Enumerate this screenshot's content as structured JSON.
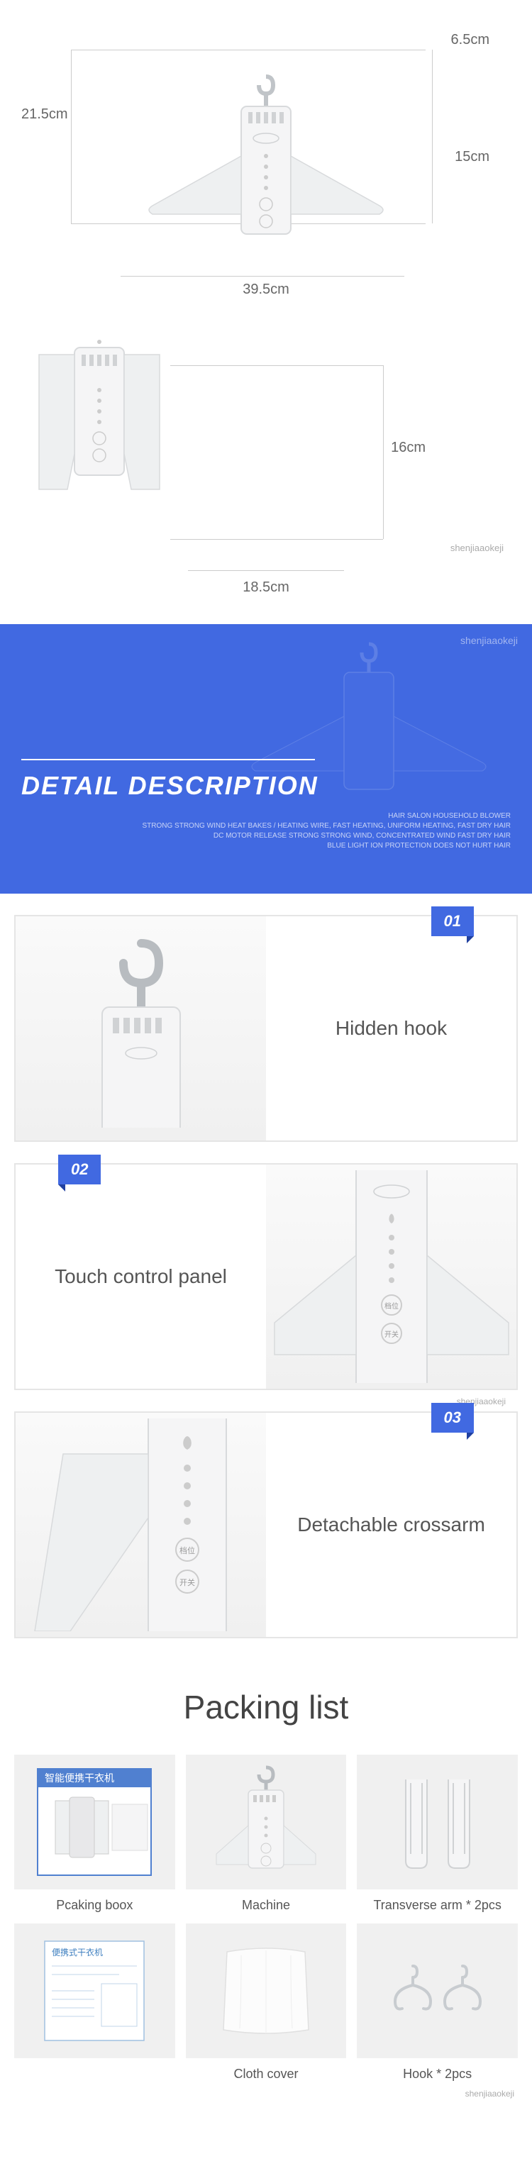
{
  "dimensions": {
    "open": {
      "hook_height": "6.5cm",
      "body_height": "21.5cm",
      "arm_depth": "15cm",
      "width": "39.5cm"
    },
    "folded": {
      "height": "16cm",
      "width": "18.5cm",
      "watermark": "shenjiaaokeji"
    }
  },
  "detail_header": {
    "corner": "shenjiaaokeji",
    "title": "DETAIL DESCRIPTION",
    "subtitle": "HAIR SALON HOUSEHOLD BLOWER\nSTRONG STRONG WIND HEAT BAKES / HEATING WIRE, FAST HEATING, UNIFORM HEATING, FAST DRY HAIR\nDC MOTOR RELEASE STRONG STRONG WIND, CONCENTRATED WIND FAST DRY HAIR\nBLUE LIGHT ION PROTECTION DOES NOT HURT HAIR"
  },
  "details": [
    {
      "badge": "01",
      "text": "Hidden hook",
      "side": "right"
    },
    {
      "badge": "02",
      "text": "Touch control panel",
      "side": "left",
      "watermark": "shenjiaaokeji"
    },
    {
      "badge": "03",
      "text": "Detachable crossarm",
      "side": "right"
    }
  ],
  "packing": {
    "title": "Packing list",
    "items": [
      {
        "label": "Pcaking boox",
        "box_title": "智能便携干衣机"
      },
      {
        "label": "Machine"
      },
      {
        "label": "Transverse arm * 2pcs"
      },
      {
        "label": ""
      },
      {
        "label": "Cloth cover"
      },
      {
        "label": "Hook * 2pcs"
      }
    ],
    "watermark": "shenjiaaokeji"
  }
}
